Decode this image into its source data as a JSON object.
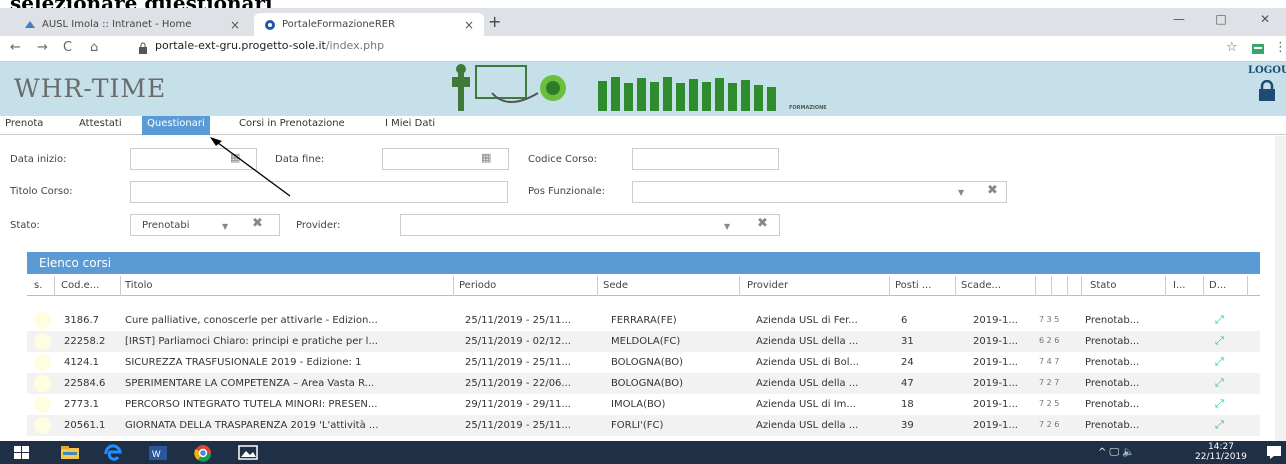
{
  "heading": "selezionare questionari",
  "browser": {
    "tabs": [
      {
        "label": "AUSL Imola :: Intranet - Home",
        "close": "×"
      },
      {
        "label": "PortaleFormazioneRER",
        "close": "×"
      }
    ],
    "new_tab": "+",
    "controls": {
      "minimize": "—",
      "maximize": "□",
      "close": "✕"
    },
    "nav": {
      "back": "←",
      "forward": "→",
      "reload": "C",
      "home": "⌂"
    },
    "url_host": "portale-ext-gru.progetto-sole.it",
    "url_path": "/index.php",
    "star": "☆",
    "menu": "⋮"
  },
  "app": {
    "logo": "WHR-TIME",
    "banner_label": "FORMAZIONE",
    "logout": "LOGOUT",
    "menu": [
      "Prenota",
      "Attestati",
      "Questionari",
      "Corsi in Prenotazione",
      "I Miei Dati"
    ],
    "active_menu": "Questionari"
  },
  "filters": {
    "data_inizio": "Data inizio:",
    "data_fine": "Data fine:",
    "codice_corso": "Codice Corso:",
    "titolo_corso": "Titolo Corso:",
    "pos_funzionale": "Pos Funzionale:",
    "stato": "Stato:",
    "stato_value": "Prenotabi",
    "provider": "Provider:"
  },
  "list": {
    "title": "Elenco corsi",
    "columns": [
      "s.",
      "Cod.e...",
      "Titolo",
      "Periodo",
      "Sede",
      "Provider",
      "Posti ...",
      "Scade...",
      "",
      "",
      "Stato",
      "I...",
      "D..."
    ],
    "rows": [
      {
        "cod": "3186.7",
        "titolo": "Cure palliative, conoscerle per attivarle - Edizion...",
        "periodo": "25/11/2019 - 25/11...",
        "sede": "FERRARA(FE)",
        "provider": "Azienda USL di Fer...",
        "posti": "6",
        "scade": "2019-1...",
        "extra": "7 3 5",
        "stato": "Prenotab..."
      },
      {
        "cod": "22258.2",
        "titolo": "[IRST] Parliamoci Chiaro: principi e pratiche per l...",
        "periodo": "25/11/2019 - 02/12...",
        "sede": "MELDOLA(FC)",
        "provider": "Azienda USL della ...",
        "posti": "31",
        "scade": "2019-1...",
        "extra": "6 2 6",
        "stato": "Prenotab..."
      },
      {
        "cod": "4124.1",
        "titolo": "SICUREZZA TRASFUSIONALE 2019 - Edizione: 1",
        "periodo": "25/11/2019 - 25/11...",
        "sede": "BOLOGNA(BO)",
        "provider": "Azienda USL di Bol...",
        "posti": "24",
        "scade": "2019-1...",
        "extra": "7 4 7",
        "stato": "Prenotab..."
      },
      {
        "cod": "22584.6",
        "titolo": "SPERIMENTARE LA COMPETENZA – Area Vasta R...",
        "periodo": "25/11/2019 - 22/06...",
        "sede": "BOLOGNA(BO)",
        "provider": "Azienda USL della ...",
        "posti": "47",
        "scade": "2019-1...",
        "extra": "7 2 7",
        "stato": "Prenotab..."
      },
      {
        "cod": "2773.1",
        "titolo": "PERCORSO INTEGRATO TUTELA MINORI: PRESEN...",
        "periodo": "29/11/2019 - 29/11...",
        "sede": "IMOLA(BO)",
        "provider": "Azienda USL di Im...",
        "posti": "18",
        "scade": "2019-1...",
        "extra": "7 2 5",
        "stato": "Prenotab..."
      },
      {
        "cod": "20561.1",
        "titolo": "GIORNATA DELLA TRASPARENZA 2019 'L'attività ...",
        "periodo": "25/11/2019 - 25/11...",
        "sede": "FORLI'(FC)",
        "provider": "Azienda USL della ...",
        "posti": "39",
        "scade": "2019-1...",
        "extra": "7 2 6",
        "stato": "Prenotab..."
      }
    ]
  },
  "taskbar": {
    "tray": "^ 🖵 🔈",
    "time": "14:27",
    "date": "22/11/2019"
  },
  "colors": {
    "accent": "#5b9bd5",
    "header_bg": "#c5e0e8",
    "taskbar": "#1f2f45"
  }
}
